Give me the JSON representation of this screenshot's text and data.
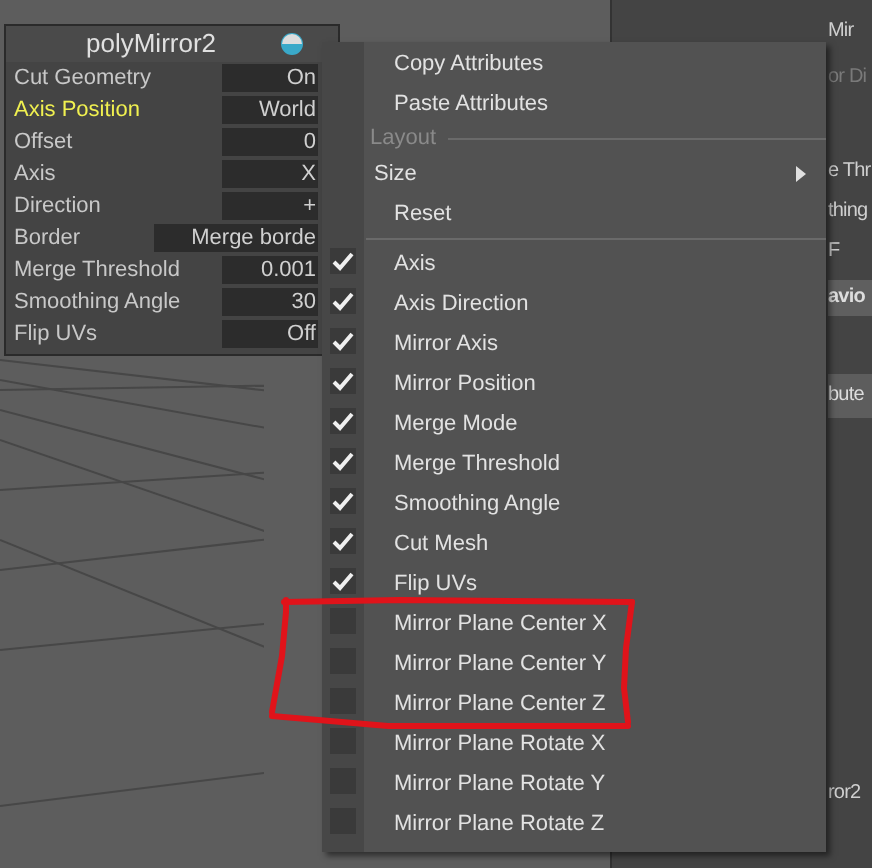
{
  "node_panel": {
    "title": "polyMirror2",
    "attributes": [
      {
        "label": "Cut Geometry",
        "value": "On",
        "highlighted": false
      },
      {
        "label": "Axis Position",
        "value": "World",
        "highlighted": true
      },
      {
        "label": "Offset",
        "value": "0",
        "highlighted": false
      },
      {
        "label": "Axis",
        "value": "X",
        "highlighted": false
      },
      {
        "label": "Direction",
        "value": "+",
        "highlighted": false
      },
      {
        "label": "Border",
        "value": "Merge borde",
        "highlighted": false
      },
      {
        "label": "Merge Threshold",
        "value": "0.001",
        "highlighted": false
      },
      {
        "label": "Smoothing Angle",
        "value": "30",
        "highlighted": false
      },
      {
        "label": "Flip UVs",
        "value": "Off",
        "highlighted": false
      }
    ]
  },
  "background_panel": {
    "fragments": [
      {
        "kind": "label",
        "text": "Mir"
      },
      {
        "kind": "dim",
        "text": "or Di"
      },
      {
        "kind": "label",
        "text": "e Thr"
      },
      {
        "kind": "label",
        "text": "thing"
      },
      {
        "kind": "label",
        "text": "F"
      },
      {
        "kind": "bar",
        "text": "avio"
      },
      {
        "kind": "button",
        "text": "bute"
      },
      {
        "kind": "label",
        "text": "ror2"
      }
    ]
  },
  "context_menu": {
    "items": [
      {
        "kind": "action",
        "label": "Copy Attributes"
      },
      {
        "kind": "action",
        "label": "Paste Attributes"
      },
      {
        "kind": "section",
        "label": "Layout"
      },
      {
        "kind": "submenu",
        "label": "Size"
      },
      {
        "kind": "action",
        "label": "Reset"
      },
      {
        "kind": "separator"
      },
      {
        "kind": "check",
        "label": "Axis",
        "checked": true
      },
      {
        "kind": "check",
        "label": "Axis Direction",
        "checked": true
      },
      {
        "kind": "check",
        "label": "Mirror Axis",
        "checked": true
      },
      {
        "kind": "check",
        "label": "Mirror Position",
        "checked": true
      },
      {
        "kind": "check",
        "label": "Merge Mode",
        "checked": true
      },
      {
        "kind": "check",
        "label": "Merge Threshold",
        "checked": true
      },
      {
        "kind": "check",
        "label": "Smoothing Angle",
        "checked": true
      },
      {
        "kind": "check",
        "label": "Cut Mesh",
        "checked": true
      },
      {
        "kind": "check",
        "label": "Flip UVs",
        "checked": true
      },
      {
        "kind": "check",
        "label": "Mirror Plane Center X",
        "checked": false
      },
      {
        "kind": "check",
        "label": "Mirror Plane Center Y",
        "checked": false
      },
      {
        "kind": "check",
        "label": "Mirror Plane Center Z",
        "checked": false
      },
      {
        "kind": "check",
        "label": "Mirror Plane Rotate X",
        "checked": false
      },
      {
        "kind": "check",
        "label": "Mirror Plane Rotate Y",
        "checked": false
      },
      {
        "kind": "check",
        "label": "Mirror Plane Rotate Z",
        "checked": false
      }
    ]
  }
}
